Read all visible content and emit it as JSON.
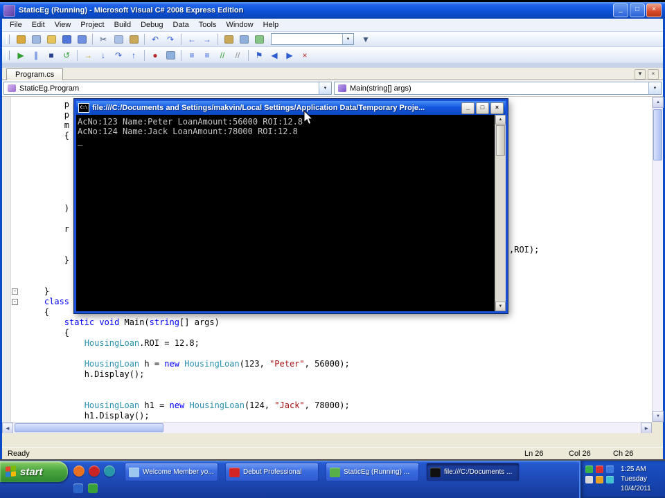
{
  "titlebar": {
    "title": "StaticEg (Running) - Microsoft Visual C# 2008 Express Edition"
  },
  "window_controls": {
    "minimize": "_",
    "maximize": "□",
    "close": "×"
  },
  "menubar": {
    "items": [
      "File",
      "Edit",
      "View",
      "Project",
      "Build",
      "Debug",
      "Data",
      "Tools",
      "Window",
      "Help"
    ]
  },
  "toolbar1": {
    "icons_left": [
      {
        "name": "new-project-icon",
        "color": "#d9a93f"
      },
      {
        "name": "add-item-icon",
        "color": "#9db7e0"
      },
      {
        "name": "open-file-icon",
        "color": "#e6c35c"
      },
      {
        "name": "save-icon",
        "color": "#4f76d8"
      },
      {
        "name": "save-all-icon",
        "color": "#6f8fe0"
      },
      {
        "sep": true
      },
      {
        "name": "cut-icon",
        "glyph": "✂",
        "color": "#44597e"
      },
      {
        "name": "copy-icon",
        "color": "#aac2e8"
      },
      {
        "name": "paste-icon",
        "color": "#c9a85a"
      },
      {
        "sep": true
      },
      {
        "name": "undo-icon",
        "glyph": "↶",
        "color": "#2d5bd0"
      },
      {
        "name": "redo-icon",
        "glyph": "↷",
        "color": "#2d5bd0"
      },
      {
        "sep": true
      },
      {
        "name": "navigate-backward-icon",
        "glyph": "←",
        "color": "#2d5bd0"
      },
      {
        "name": "navigate-forward-icon",
        "glyph": "→",
        "color": "#2d5bd0"
      },
      {
        "sep": true
      },
      {
        "name": "solution-explorer-icon",
        "color": "#c9a85a"
      },
      {
        "name": "properties-window-icon",
        "color": "#8fb0dd"
      },
      {
        "name": "object-browser-icon",
        "color": "#86c586"
      }
    ],
    "combo_value": "",
    "combo_arrow": "▼",
    "icons_right": [
      {
        "name": "toolbar-options-icon",
        "glyph": "▼",
        "color": "#44597e"
      }
    ]
  },
  "toolbar2": {
    "icons": [
      {
        "name": "continue-icon",
        "glyph": "▶",
        "color": "#2f9e2f"
      },
      {
        "name": "break-all-icon",
        "glyph": "∥",
        "color": "#2d5bd0"
      },
      {
        "name": "stop-debugging-icon",
        "glyph": "■",
        "color": "#27408f"
      },
      {
        "name": "restart-icon",
        "glyph": "↺",
        "color": "#2f9e2f"
      },
      {
        "sep": true
      },
      {
        "name": "show-next-statement-icon",
        "glyph": "→",
        "color": "#c9a21a"
      },
      {
        "name": "step-into-icon",
        "glyph": "↓",
        "color": "#2d5bd0"
      },
      {
        "name": "step-over-icon",
        "glyph": "↷",
        "color": "#2d5bd0"
      },
      {
        "name": "step-out-icon",
        "glyph": "↑",
        "color": "#2d5bd0"
      },
      {
        "sep": true
      },
      {
        "name": "breakpoints-window-icon",
        "glyph": "●",
        "color": "#b03030"
      },
      {
        "name": "output-window-icon",
        "color": "#8fb0dd"
      },
      {
        "sep": true
      },
      {
        "name": "decrease-indent-icon",
        "glyph": "≡",
        "color": "#2d5bd0"
      },
      {
        "name": "increase-indent-icon",
        "glyph": "≡",
        "color": "#2d5bd0"
      },
      {
        "name": "comment-icon",
        "glyph": "//",
        "color": "#2f9e2f"
      },
      {
        "name": "uncomment-icon",
        "glyph": "//",
        "color": "#8a8a8a"
      },
      {
        "sep": true
      },
      {
        "name": "toggle-bookmark-icon",
        "glyph": "⚑",
        "color": "#2d5bd0"
      },
      {
        "name": "previous-bookmark-icon",
        "glyph": "◀",
        "color": "#2d5bd0"
      },
      {
        "name": "next-bookmark-icon",
        "glyph": "▶",
        "color": "#2d5bd0"
      },
      {
        "name": "clear-bookmarks-icon",
        "glyph": "×",
        "color": "#b03030"
      }
    ]
  },
  "tabstrip": {
    "tabs": [
      {
        "label": "Program.cs"
      }
    ],
    "dropdown_glyph": "▼",
    "close_glyph": "×"
  },
  "scroll": {
    "up": "▲",
    "down": "▼",
    "left": "◀",
    "right": "▶"
  },
  "editor": {
    "type_combo": "StaticEg.Program",
    "member_combo": "Main(string[] args)",
    "combo_arrow": "▼",
    "lines": [
      {
        "ind": 8,
        "toks": [
          [
            "p",
            "n"
          ]
        ]
      },
      {
        "ind": 8,
        "toks": [
          [
            "p",
            "n"
          ]
        ]
      },
      {
        "ind": 8,
        "toks": [
          [
            "m",
            "n"
          ]
        ]
      },
      {
        "ind": 8,
        "toks": [
          [
            "{",
            "n"
          ]
        ]
      },
      {},
      {},
      {},
      {},
      {},
      {},
      {
        "ind": 8,
        "toks": [
          [
            ")",
            "n"
          ]
        ]
      },
      {},
      {
        "ind": 8,
        "toks": [
          [
            "r",
            "n"
          ]
        ]
      },
      {},
      {
        "tail": true,
        "toks": [
          [
            ",ROI);",
            "n"
          ]
        ]
      },
      {
        "ind": 8,
        "toks": [
          [
            "}",
            "n"
          ]
        ]
      },
      {},
      {},
      {
        "ind": 4,
        "fold": true,
        "toks": [
          [
            "}",
            "n"
          ]
        ]
      },
      {
        "ind": 4,
        "fold": true,
        "toks": [
          [
            "class",
            "k"
          ]
        ]
      },
      {
        "ind": 4,
        "toks": [
          [
            "{",
            "n"
          ]
        ]
      },
      {
        "ind": 8,
        "toks": [
          [
            "static",
            "k"
          ],
          [
            " ",
            "n"
          ],
          [
            "void",
            "k"
          ],
          [
            " Main(",
            "n"
          ],
          [
            "string",
            "k"
          ],
          [
            "[] args)",
            "n"
          ]
        ]
      },
      {
        "ind": 8,
        "toks": [
          [
            "{",
            "n"
          ]
        ]
      },
      {
        "ind": 12,
        "toks": [
          [
            "HousingLoan",
            "t"
          ],
          [
            ".ROI = 12.8;",
            "n"
          ]
        ]
      },
      {},
      {
        "ind": 12,
        "toks": [
          [
            "HousingLoan",
            "t"
          ],
          [
            " h = ",
            "n"
          ],
          [
            "new",
            "k"
          ],
          [
            " ",
            "n"
          ],
          [
            "HousingLoan",
            "t"
          ],
          [
            "(123, ",
            "n"
          ],
          [
            "\"Peter\"",
            "s"
          ],
          [
            ", 56000);",
            "n"
          ]
        ]
      },
      {
        "ind": 12,
        "toks": [
          [
            "h.Display();",
            "n"
          ]
        ]
      },
      {},
      {},
      {
        "ind": 12,
        "toks": [
          [
            "HousingLoan",
            "t"
          ],
          [
            " h1 = ",
            "n"
          ],
          [
            "new",
            "k"
          ],
          [
            " ",
            "n"
          ],
          [
            "HousingLoan",
            "t"
          ],
          [
            "(124, ",
            "n"
          ],
          [
            "\"Jack\"",
            "s"
          ],
          [
            ", 78000);",
            "n"
          ]
        ]
      },
      {
        "ind": 12,
        "toks": [
          [
            "h1.Display();",
            "n"
          ]
        ]
      }
    ]
  },
  "console": {
    "title": "file:///C:/Documents and Settings/makvin/Local Settings/Application Data/Temporary Proje...",
    "icon_glyph": "C:\\",
    "controls": {
      "minimize": "_",
      "maximize": "□",
      "close": "×"
    },
    "lines": [
      "AcNo:123 Name:Peter LoanAmount:56000 ROI:12.8",
      "AcNo:124 Name:Jack LoanAmount:78000 ROI:12.8",
      "_"
    ]
  },
  "statusbar": {
    "status": "Ready",
    "ln": "Ln 26",
    "col": "Col 26",
    "ch": "Ch 26"
  },
  "taskbar": {
    "start_label": "start",
    "quick_launch": [
      {
        "name": "quick-launch-internet-icon",
        "color": "#e87020"
      },
      {
        "name": "quick-launch-media-icon",
        "color": "#cc2424"
      },
      {
        "name": "quick-launch-show-desktop-icon",
        "color": "#2898a8"
      }
    ],
    "extra_icons": [
      {
        "name": "taskbar-notify-icon-1",
        "color": "#2a64c8"
      },
      {
        "name": "taskbar-notify-icon-2",
        "color": "#38a038"
      }
    ],
    "tasks": [
      {
        "label": "Welcome Member yo...",
        "icon": "task-icon-browser",
        "icon_color": "#9cc6f0",
        "active": false
      },
      {
        "label": "Debut Professional",
        "icon": "task-icon-debut",
        "icon_color": "#d42424",
        "active": false
      },
      {
        "label": "StaticEg (Running) ...",
        "icon": "task-icon-vs",
        "icon_color": "#58b048",
        "active": false
      },
      {
        "label": "file:///C:/Documents ...",
        "icon": "task-icon-console",
        "icon_color": "#101010",
        "active": true
      }
    ],
    "tray": {
      "icons": [
        {
          "name": "tray-antivirus-icon",
          "color": "#38b048"
        },
        {
          "name": "tray-alert-icon",
          "color": "#d83030"
        },
        {
          "name": "tray-network-icon",
          "color": "#3a78e0"
        },
        {
          "name": "tray-volume-icon",
          "color": "#d8d8d8"
        },
        {
          "name": "tray-update-icon",
          "color": "#e8a020"
        },
        {
          "name": "tray-messenger-icon",
          "color": "#40c0d0"
        }
      ],
      "time": "1:25 AM",
      "day": "Tuesday",
      "date": "10/4/2011"
    }
  }
}
